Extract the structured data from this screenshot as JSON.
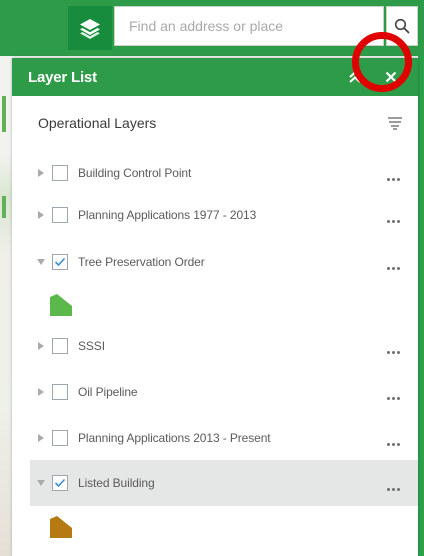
{
  "search": {
    "placeholder": "Find an address or place"
  },
  "panel": {
    "title": "Layer List",
    "section_title": "Operational Layers"
  },
  "layers": [
    {
      "label": "Building Control Point",
      "checked": false,
      "expanded": false
    },
    {
      "label": "Planning Applications 1977 - 2013",
      "checked": false,
      "expanded": false
    },
    {
      "label": "Tree Preservation Order",
      "checked": true,
      "expanded": true,
      "legend_color": "#5cb84a"
    },
    {
      "label": "SSSI",
      "checked": false,
      "expanded": false
    },
    {
      "label": "Oil Pipeline",
      "checked": false,
      "expanded": false
    },
    {
      "label": "Planning Applications 2013 - Present",
      "checked": false,
      "expanded": false
    },
    {
      "label": "Listed Building",
      "checked": true,
      "expanded": true,
      "selected": true,
      "legend_color": "#b57a12"
    }
  ],
  "colors": {
    "header_green": "#2e9b48",
    "button_green": "#168c3c",
    "highlight_ring": "#e10000",
    "check_blue": "#3a8fd6"
  },
  "icons": {
    "layers_button": "layers-stack-icon",
    "search_button": "magnifier-icon",
    "collapse": "double-chevron-up-icon",
    "close": "close-icon",
    "filter": "filter-list-icon",
    "more": "ellipsis-icon"
  }
}
